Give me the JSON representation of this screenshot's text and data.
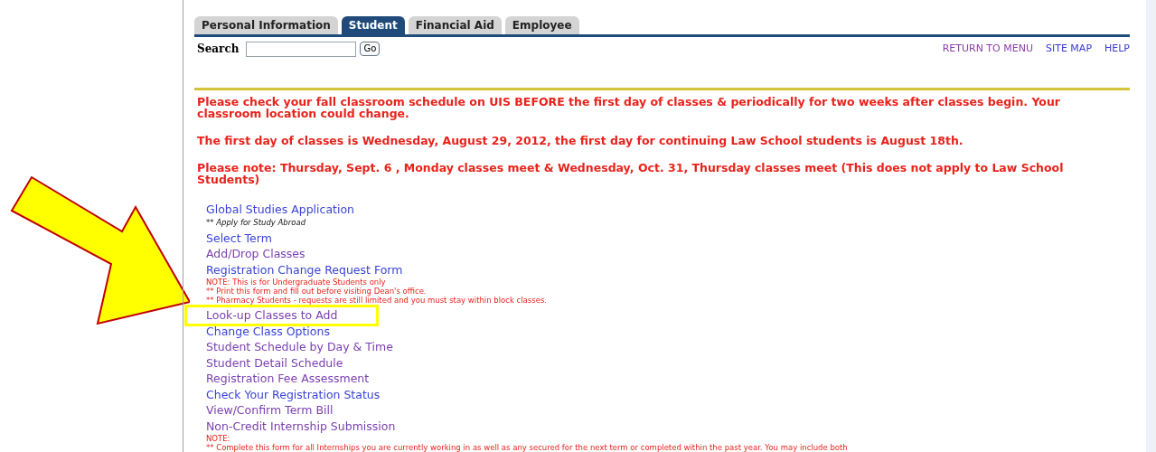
{
  "tabs": [
    {
      "label": "Personal Information",
      "selected": false
    },
    {
      "label": "Student",
      "selected": true
    },
    {
      "label": "Financial Aid",
      "selected": false
    },
    {
      "label": "Employee",
      "selected": false
    }
  ],
  "search": {
    "label": "Search",
    "button": "Go"
  },
  "top_links": [
    {
      "label": "RETURN TO MENU",
      "visited": true
    },
    {
      "label": "SITE MAP",
      "visited": false
    },
    {
      "label": "HELP",
      "visited": false
    }
  ],
  "notices": [
    "Please check your fall classroom schedule on UIS BEFORE the first day of classes & periodically for two weeks after classes begin. Your classroom location could change.",
    "The first day of classes is Wednesday, August 29, 2012, the first day for continuing Law School students is August 18th.",
    "Please note: Thursday, Sept. 6 , Monday classes meet & Wednesday, Oct. 31, Thursday classes meet (This does not apply to Law School Students)"
  ],
  "menu": [
    {
      "label": "Global Studies Application",
      "visited": false,
      "highlighted": false,
      "notes": [
        {
          "kind": "info",
          "text": "** Apply for Study Abroad"
        }
      ]
    },
    {
      "label": "Select Term",
      "visited": false,
      "highlighted": false
    },
    {
      "label": "Add/Drop Classes",
      "visited": true,
      "highlighted": false
    },
    {
      "label": "Registration Change Request Form",
      "visited": false,
      "highlighted": false,
      "notes": [
        {
          "kind": "warning",
          "text": "NOTE: This is for Undergraduate Students only"
        },
        {
          "kind": "warning",
          "text": "** Print this form and fill out before visiting Dean's office."
        },
        {
          "kind": "warning",
          "text": "** Pharmacy Students - requests are still limited and you must stay within block classes."
        }
      ]
    },
    {
      "label": "Look-up Classes to Add",
      "visited": true,
      "highlighted": true
    },
    {
      "label": "Change Class Options",
      "visited": false,
      "highlighted": false
    },
    {
      "label": "Student Schedule by Day & Time",
      "visited": true,
      "highlighted": false
    },
    {
      "label": "Student Detail Schedule",
      "visited": true,
      "highlighted": false
    },
    {
      "label": "Registration Fee Assessment",
      "visited": true,
      "highlighted": false
    },
    {
      "label": "Check Your Registration Status",
      "visited": false,
      "highlighted": false
    },
    {
      "label": "View/Confirm Term Bill",
      "visited": true,
      "highlighted": false
    },
    {
      "label": "Non-Credit Internship Submission",
      "visited": true,
      "highlighted": false,
      "notes": [
        {
          "kind": "warning",
          "text": "NOTE:"
        },
        {
          "kind": "warning",
          "text": "** Complete this form for all Internships you are currently working in as well as any secured for the next term or completed within the past year. You may include both"
        }
      ]
    }
  ]
}
